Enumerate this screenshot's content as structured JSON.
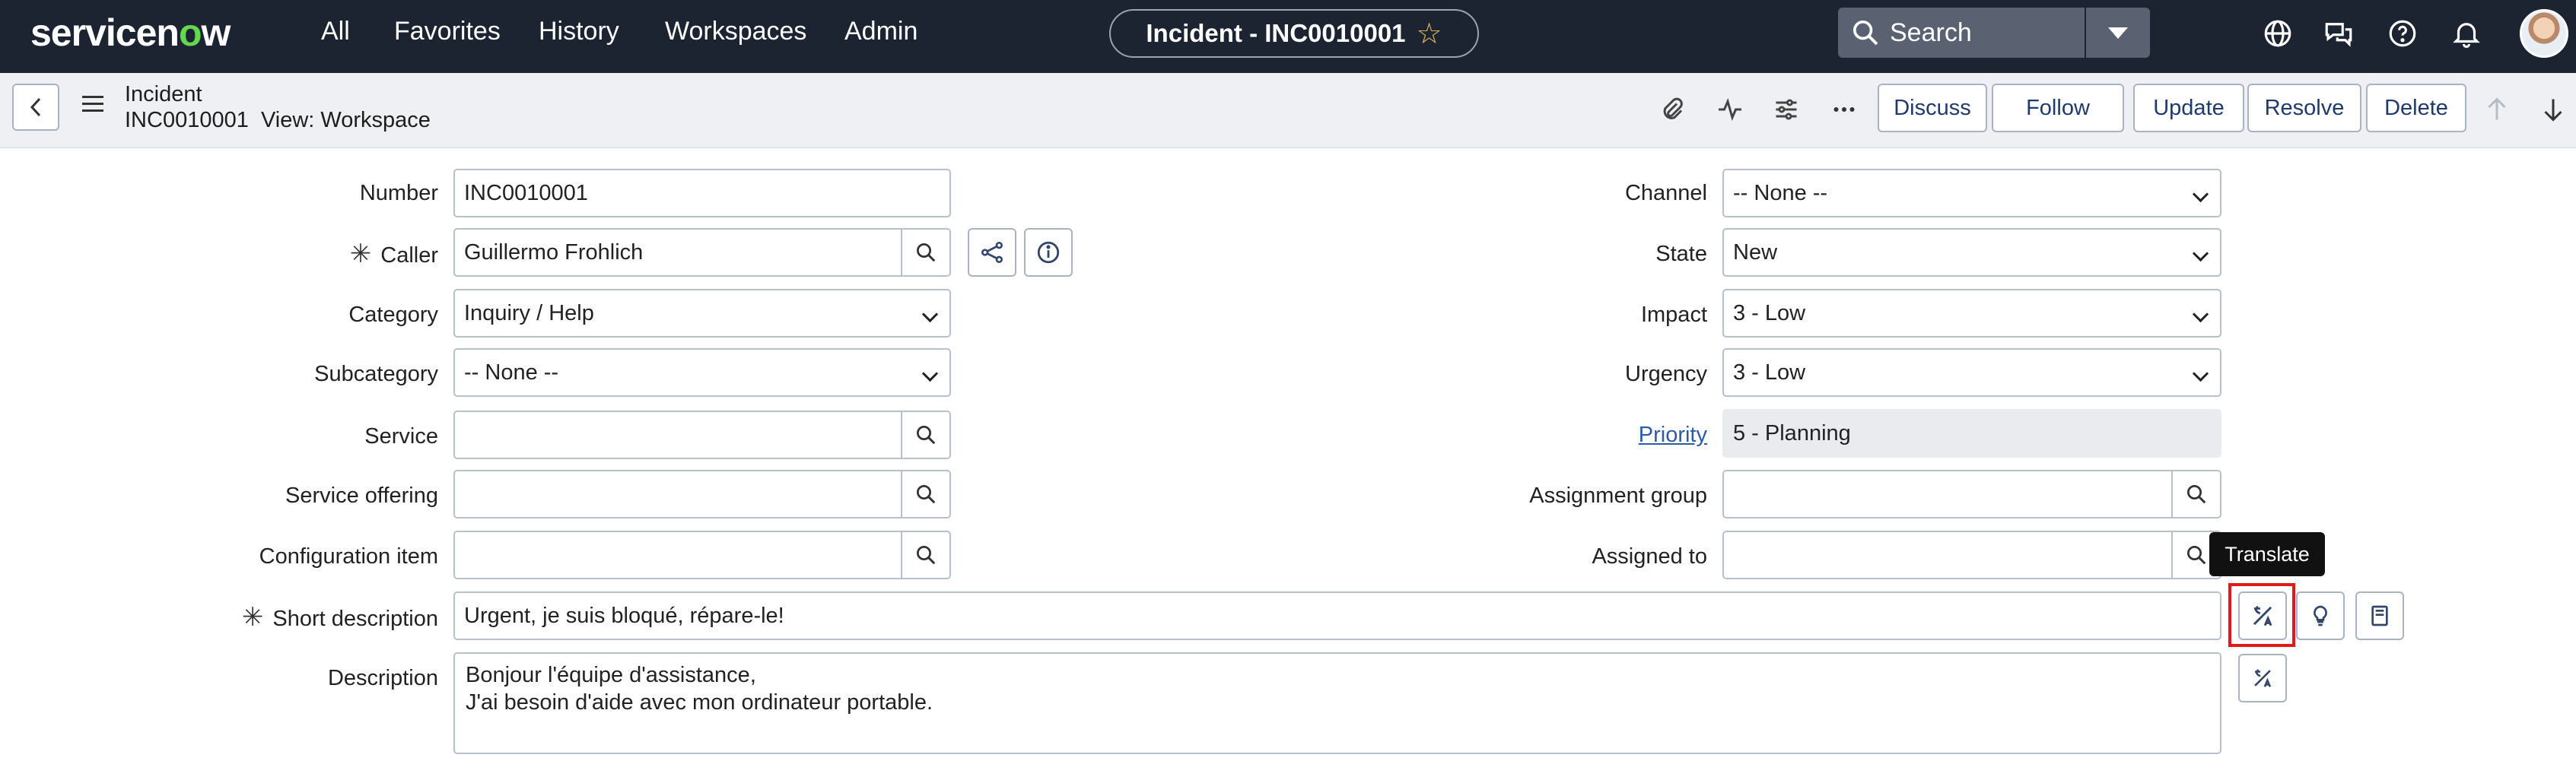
{
  "brand": {
    "name_pre": "servicen",
    "name_o": "o",
    "name_post": "w"
  },
  "nav": {
    "links": [
      "All",
      "Favorites",
      "History",
      "Workspaces",
      "Admin"
    ],
    "context_title": "Incident - INC0010001",
    "search_label": "Search"
  },
  "header": {
    "record_type": "Incident",
    "record_number": "INC0010001",
    "view_label": "View: Workspace",
    "buttons": {
      "discuss": "Discuss",
      "follow": "Follow",
      "update": "Update",
      "resolve": "Resolve",
      "delete": "Delete"
    }
  },
  "form": {
    "number": {
      "label": "Number",
      "value": "INC0010001"
    },
    "caller": {
      "label": "Caller",
      "value": "Guillermo Frohlich"
    },
    "category": {
      "label": "Category",
      "value": "Inquiry / Help"
    },
    "subcategory": {
      "label": "Subcategory",
      "value": "-- None --"
    },
    "service": {
      "label": "Service",
      "value": ""
    },
    "service_offering": {
      "label": "Service offering",
      "value": ""
    },
    "configuration_item": {
      "label": "Configuration item",
      "value": ""
    },
    "short_description": {
      "label": "Short description",
      "value": "Urgent, je suis bloqué, répare-le!"
    },
    "description": {
      "label": "Description",
      "line1": "Bonjour l'équipe d'assistance,",
      "line2": "J'ai besoin d'aide avec mon ordinateur portable."
    },
    "channel": {
      "label": "Channel",
      "value": "-- None --"
    },
    "state": {
      "label": "State",
      "value": "New"
    },
    "impact": {
      "label": "Impact",
      "value": "3 - Low"
    },
    "urgency": {
      "label": "Urgency",
      "value": "3 - Low"
    },
    "priority": {
      "label": "Priority",
      "value": "5 - Planning"
    },
    "assignment_group": {
      "label": "Assignment group",
      "value": ""
    },
    "assigned_to": {
      "label": "Assigned to",
      "value": ""
    }
  },
  "tooltip": {
    "translate": "Translate"
  },
  "colors": {
    "nav_bg": "#1c2331",
    "accent_green": "#62d84e",
    "highlight": "#e01a1a"
  }
}
